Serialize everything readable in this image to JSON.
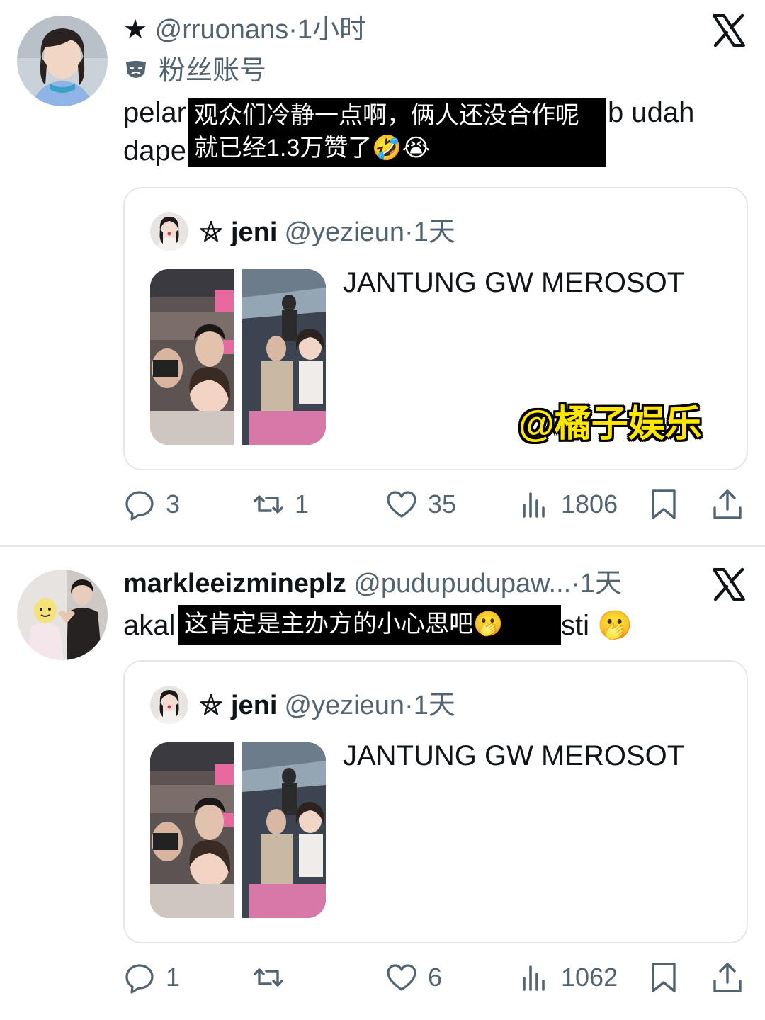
{
  "posts": [
    {
      "author_prefix": "★",
      "handle": "@rruonans",
      "time": "1小时",
      "fan_label": "粉丝账号",
      "text_line1_left": "pelar",
      "text_line1_right": "b udah",
      "text_line2_left": "dape",
      "overlay_line1": "观众们冷静一点啊，俩人还没合作呢",
      "overlay_line2": "就已经1.3万赞了🤣😭",
      "quote": {
        "name": "jeni",
        "handle": "@yezieun",
        "time": "1天",
        "text": "JANTUNG GW MEROSOT"
      },
      "watermark": "@橘子娱乐",
      "actions": {
        "replies": "3",
        "retweets": "1",
        "likes": "35",
        "views": "1806"
      }
    },
    {
      "name": "markleeizmineplz",
      "handle": "@pudupudupaw...",
      "time": "1天",
      "text_left": "akal",
      "text_right": "sti 🫢",
      "overlay": "这肯定是主办方的小心思吧🫢",
      "quote": {
        "name": "jeni",
        "handle": "@yezieun",
        "time": "1天",
        "text": "JANTUNG GW MEROSOT"
      },
      "actions": {
        "replies": "1",
        "retweets": "",
        "likes": "6",
        "views": "1062"
      }
    }
  ],
  "separator": "·",
  "colors": {
    "text": "#0f1419",
    "muted": "#536471",
    "border": "#e3e7ea",
    "watermark": "#ffe600"
  },
  "icons": [
    "x-logo-icon",
    "mask-icon",
    "pentagram-icon",
    "reply-icon",
    "retweet-icon",
    "like-icon",
    "views-icon",
    "bookmark-icon",
    "share-icon"
  ]
}
